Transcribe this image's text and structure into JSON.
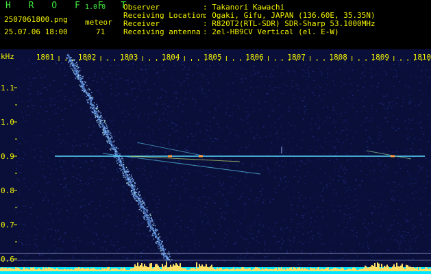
{
  "header": {
    "app_logo": "H R O F F T",
    "version": "1.0.0",
    "filename": "2507061800.png",
    "datetime": "25.07.06 18:00",
    "meteor_label": "meteor",
    "meteor_count": "71",
    "info": [
      {
        "label": "Observer",
        "value": ": Takanori Kawachi"
      },
      {
        "label": "Receiving Location",
        "value": ": Ogaki, Gifu, JAPAN (136.60E, 35.35N)"
      },
      {
        "label": "Receiver",
        "value": ": R820T2(RTL-SDR) SDR-Sharp 53.1000MHz"
      },
      {
        "label": "Receiving antenna",
        "value": ": 2el-HB9CV Vertical (el. E-W)"
      }
    ]
  },
  "spectrogram": {
    "freq_unit": "kHz",
    "freq_ticks": [
      {
        "label": "1.1",
        "value": 1.1
      },
      {
        "label": "1.0",
        "value": 1.0
      },
      {
        "label": "0.9",
        "value": 0.9
      },
      {
        "label": "0.8",
        "value": 0.8
      },
      {
        "label": "0.7",
        "value": 0.7
      },
      {
        "label": "0.6",
        "value": 0.6
      }
    ],
    "time_ticks": [
      "1801",
      "1802",
      "1803",
      "1804",
      "1805",
      "1806",
      "1807",
      "1808",
      "1809",
      "1810"
    ],
    "colors": {
      "background": "#0a0f3a",
      "noise": "#2a3aa8",
      "carrier": "#5ad8ff",
      "hot": "#ffe066",
      "axis": "#f2f200",
      "level": "#00e5ff"
    }
  }
}
